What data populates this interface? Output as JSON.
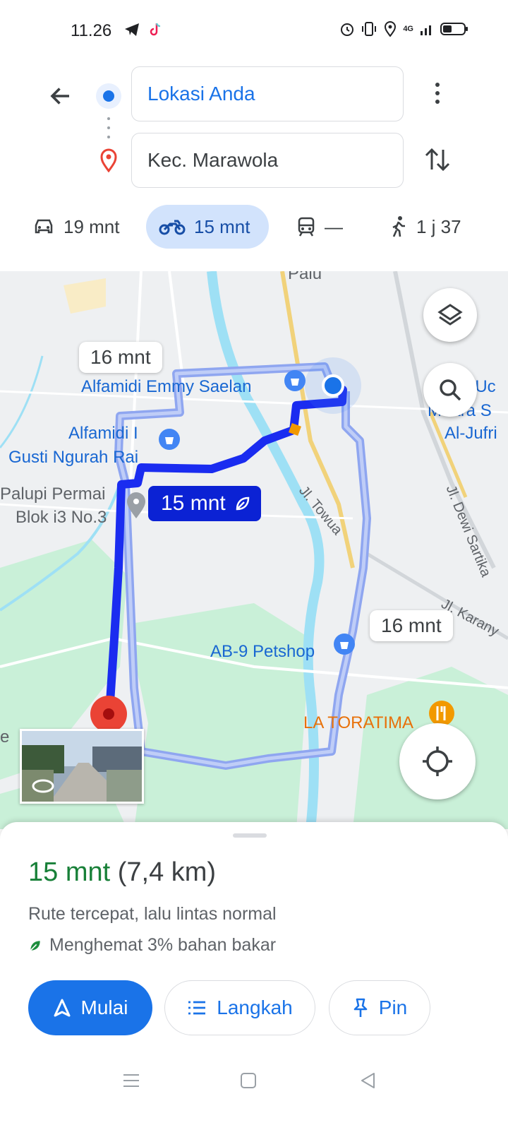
{
  "status_bar": {
    "time": "11.26",
    "signal_text": "4G",
    "icons_left": [
      "telegram-icon",
      "tiktok-icon"
    ],
    "icons_right": [
      "alarm-icon",
      "vibrate-icon",
      "location-icon",
      "signal-icon",
      "battery-icon"
    ],
    "battery_level": 0.4
  },
  "search": {
    "origin_value": "Lokasi Anda",
    "destination_value": "Kec. Marawola"
  },
  "modes": {
    "car_time": "19 mnt",
    "motorcycle_time": "15 mnt",
    "transit_time": "—",
    "walk_time": "1 j 37",
    "selected": "motorcycle"
  },
  "map": {
    "labels": {
      "palu": "Palu",
      "alfamidi_emmy": "Alfamidi Emmy Saelan",
      "alfamidi_gusti_1": "Alfamidi I",
      "alfamidi_gusti_2": "Gusti Ngurah Rai",
      "palupi_1": "Palupi Permai",
      "palupi_2": "Blok i3 No.3",
      "jl_towua": "Jl. Towua",
      "jl_dewi_sartika": "Jl. Dewi Sartika",
      "jl_karanja": "Jl. Karany",
      "petshop": "AB-9 Petshop",
      "toratima": "LA TORATIMA",
      "muara_1": "I Uc",
      "muara_2": "Muara S",
      "muara_3": "Al-Jufri",
      "edge_e": "e"
    },
    "alt_route_time_1": "16 mnt",
    "alt_route_time_2": "16 mnt",
    "selected_route_time": "15 mnt",
    "colors": {
      "route_primary": "#1a2cf0",
      "route_alt": "#8fa6f0",
      "water": "#9ee0f5",
      "park": "#c9f0d8",
      "dest_marker": "#ea4335"
    }
  },
  "sheet": {
    "duration": "15 mnt",
    "distance": "(7,4 km)",
    "description": "Rute tercepat, lalu lintas normal",
    "eco_text": "Menghemat 3% bahan bakar",
    "start_label": "Mulai",
    "steps_label": "Langkah",
    "pin_label": "Pin"
  }
}
